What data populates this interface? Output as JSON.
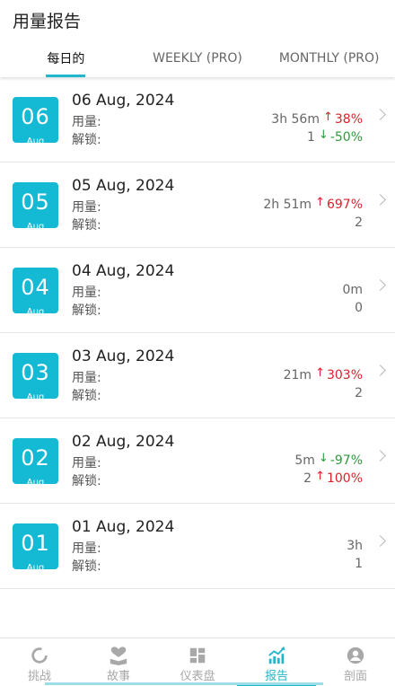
{
  "header": {
    "title": "用量报告"
  },
  "tabs": [
    {
      "label": "每日的",
      "active": true
    },
    {
      "label": "WEEKLY (PRO)",
      "active": false
    },
    {
      "label": "MONTHLY (PRO)",
      "active": false
    }
  ],
  "labels": {
    "usage": "用量:",
    "unlocks": "解锁:"
  },
  "days": [
    {
      "day": "06",
      "month": "Aug",
      "date": "06 Aug, 2024",
      "usage": "3h 56m",
      "usage_change": "38%",
      "usage_dir": "up",
      "unlocks": "1",
      "unlocks_change": "-50%",
      "unlocks_dir": "down"
    },
    {
      "day": "05",
      "month": "Aug",
      "date": "05 Aug, 2024",
      "usage": "2h 51m",
      "usage_change": "697%",
      "usage_dir": "up",
      "unlocks": "2",
      "unlocks_change": "",
      "unlocks_dir": ""
    },
    {
      "day": "04",
      "month": "Aug",
      "date": "04 Aug, 2024",
      "usage": "0m",
      "usage_change": "",
      "usage_dir": "",
      "unlocks": "0",
      "unlocks_change": "",
      "unlocks_dir": ""
    },
    {
      "day": "03",
      "month": "Aug",
      "date": "03 Aug, 2024",
      "usage": "21m",
      "usage_change": "303%",
      "usage_dir": "up",
      "unlocks": "2",
      "unlocks_change": "",
      "unlocks_dir": ""
    },
    {
      "day": "02",
      "month": "Aug",
      "date": "02 Aug, 2024",
      "usage": "5m",
      "usage_change": "-97%",
      "usage_dir": "down",
      "unlocks": "2",
      "unlocks_change": "100%",
      "unlocks_dir": "up"
    },
    {
      "day": "01",
      "month": "Aug",
      "date": "01 Aug, 2024",
      "usage": "3h",
      "usage_change": "",
      "usage_dir": "",
      "unlocks": "1",
      "unlocks_change": "",
      "unlocks_dir": ""
    }
  ],
  "bottom_nav": [
    {
      "label": "挑战",
      "icon": "challenge-icon",
      "active": false
    },
    {
      "label": "故事",
      "icon": "story-icon",
      "active": false
    },
    {
      "label": "仪表盘",
      "icon": "dashboard-icon",
      "active": false
    },
    {
      "label": "报告",
      "icon": "report-icon",
      "active": true
    },
    {
      "label": "剖面",
      "icon": "profile-icon",
      "active": false
    }
  ],
  "colors": {
    "accent": "#21b6cc",
    "badge": "#14b9d4",
    "increase": "#d8232a",
    "decrease": "#2e9a3a"
  }
}
